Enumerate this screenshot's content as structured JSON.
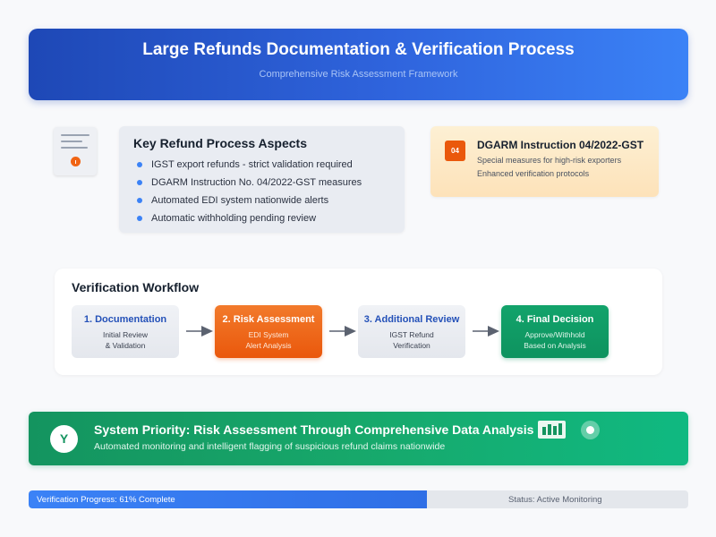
{
  "header": {
    "title": "Large Refunds Documentation & Verification Process",
    "subtitle": "Comprehensive Risk Assessment Framework"
  },
  "doc_icon": {
    "icon": "document-alert-icon",
    "badge_glyph": "!"
  },
  "aspects": {
    "title": "Key Refund Process Aspects",
    "items": [
      "IGST export refunds - strict validation required",
      "DGARM Instruction No. 04/2022-GST measures",
      "Automated EDI system nationwide alerts",
      "Automatic withholding pending review"
    ]
  },
  "dgarm": {
    "badge": "04",
    "title": "DGARM Instruction 04/2022-GST",
    "line1": "Special measures for high-risk exporters",
    "line2": "Enhanced verification protocols"
  },
  "workflow": {
    "title": "Verification Workflow",
    "steps": [
      {
        "title": "1. Documentation",
        "line1": "Initial Review",
        "line2": "& Validation"
      },
      {
        "title": "2. Risk Assessment",
        "line1": "EDI System",
        "line2": "Alert Analysis"
      },
      {
        "title": "3. Additional Review",
        "line1": "IGST Refund",
        "line2": "Verification"
      },
      {
        "title": "4. Final Decision",
        "line1": "Approve/Withhold",
        "line2": "Based on Analysis"
      }
    ]
  },
  "priority": {
    "icon_glyph": "Y",
    "title": "System Priority: Risk Assessment Through Comprehensive Data Analysis",
    "subtitle": "Automated monitoring and intelligent flagging of suspicious refund claims nationwide",
    "chart_icon": "bar-chart-icon",
    "target_icon": "target-icon"
  },
  "progress": {
    "label": "Verification Progress: 61% Complete",
    "value": 0.61,
    "status": "Status: Active Monitoring"
  },
  "colors": {
    "primary_blue": "#2f64dd",
    "accent_orange": "#ea580c",
    "success_green": "#14945f"
  }
}
